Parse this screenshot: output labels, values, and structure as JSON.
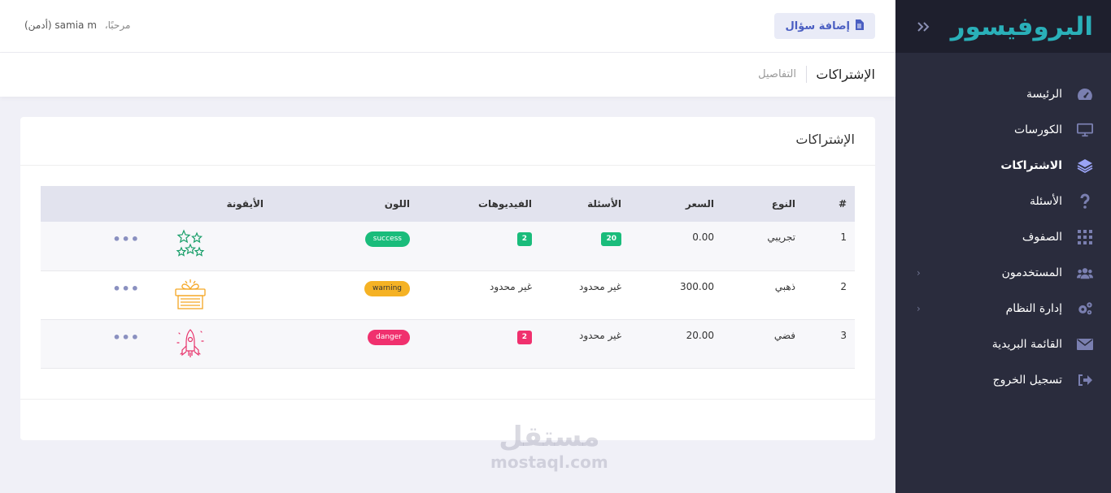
{
  "brand": {
    "name": "البروفيسور",
    "toggle_icon": "double-chevron-right-icon"
  },
  "nav": [
    {
      "label": "الرئيسة",
      "icon": "dashboard-icon",
      "active": false
    },
    {
      "label": "الكورسات",
      "icon": "monitor-icon",
      "active": false
    },
    {
      "label": "الاشتراكات",
      "icon": "layers-icon",
      "active": true
    },
    {
      "label": "الأسئلة",
      "icon": "question-icon",
      "active": false
    },
    {
      "label": "الصفوف",
      "icon": "grid-icon",
      "active": false
    },
    {
      "label": "المستخدمون",
      "icon": "users-icon",
      "active": false
    },
    {
      "label": "إدارة النظام",
      "icon": "cogs-icon",
      "active": false
    },
    {
      "label": "القائمة البريدية",
      "icon": "envelope-icon",
      "active": false
    },
    {
      "label": "تسجيل الخروج",
      "icon": "sign-out-icon",
      "active": false
    }
  ],
  "topbar": {
    "add_button": "إضافة سؤال",
    "greeting": "مرحبًا،",
    "user": "samia m (أدمن)"
  },
  "breadcrumb": {
    "title": "الإشتراكات",
    "sub": "التفاصيل"
  },
  "card": {
    "title": "الإشتراكات"
  },
  "table": {
    "headers": {
      "num": "#",
      "type": "النوع",
      "price": "السعر",
      "questions": "الأسئلة",
      "videos": "الفيديوهات",
      "color": "اللون",
      "icon": "الأيقونة"
    },
    "rows": [
      {
        "num": "1",
        "type": "تجريبي",
        "price": "0.00",
        "questions": "20",
        "videos": "2",
        "color": "success",
        "icon": "stars-icon",
        "action": "•••"
      },
      {
        "num": "2",
        "type": "ذهبي",
        "price": "300.00",
        "questions": "غير محدود",
        "videos": "غير محدود",
        "color": "warning",
        "icon": "gift-box-icon",
        "action": "•••"
      },
      {
        "num": "3",
        "type": "فضي",
        "price": "20.00",
        "questions": "غير محدود",
        "videos": "2",
        "color": "danger",
        "icon": "rocket-icon",
        "action": "•••"
      }
    ]
  },
  "colors": {
    "success": "#1abc7b",
    "warning": "#f5b224",
    "danger": "#f0306e",
    "accent": "#4a5ec2",
    "brand": "#2ab0b9"
  },
  "watermark": {
    "ar": "مستقل",
    "en": "mostaql.com"
  }
}
